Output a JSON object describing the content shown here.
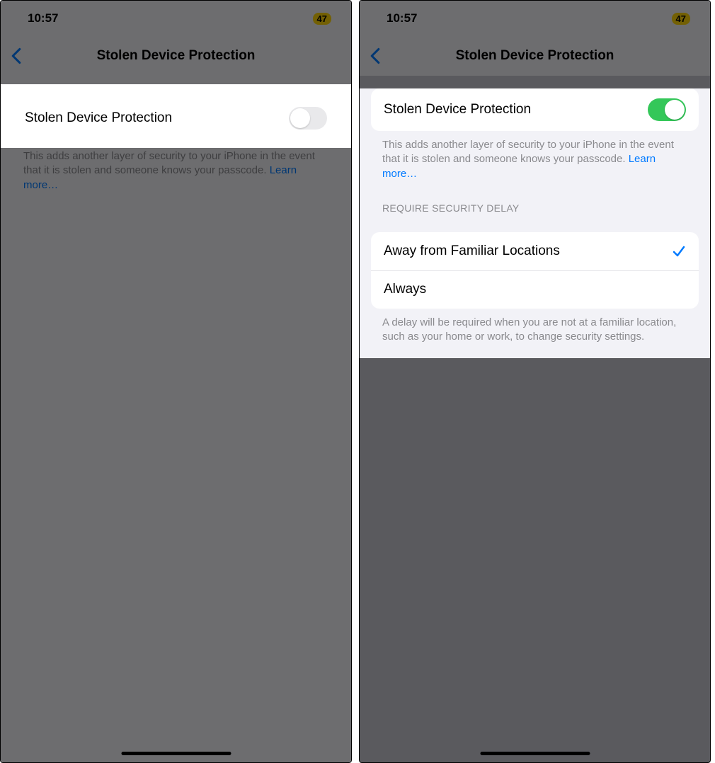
{
  "left": {
    "status": {
      "time": "10:57",
      "battery": "47"
    },
    "nav": {
      "title": "Stolen Device Protection"
    },
    "main": {
      "toggle_label": "Stolen Device Protection",
      "toggle_on": false,
      "footer_text": "This adds another layer of security to your iPhone in the event that it is stolen and someone knows your passcode. ",
      "footer_link": "Learn more…"
    }
  },
  "right": {
    "status": {
      "time": "10:57",
      "battery": "47"
    },
    "nav": {
      "title": "Stolen Device Protection"
    },
    "main": {
      "toggle_label": "Stolen Device Protection",
      "toggle_on": true,
      "footer_text": "This adds another layer of security to your iPhone in the event that it is stolen and someone knows your passcode. ",
      "footer_link": "Learn more…"
    },
    "delay": {
      "header": "REQUIRE SECURITY DELAY",
      "options": [
        {
          "label": "Away from Familiar Locations",
          "selected": true
        },
        {
          "label": "Always",
          "selected": false
        }
      ],
      "footer": "A delay will be required when you are not at a familiar location, such as your home or work, to change security settings."
    }
  }
}
